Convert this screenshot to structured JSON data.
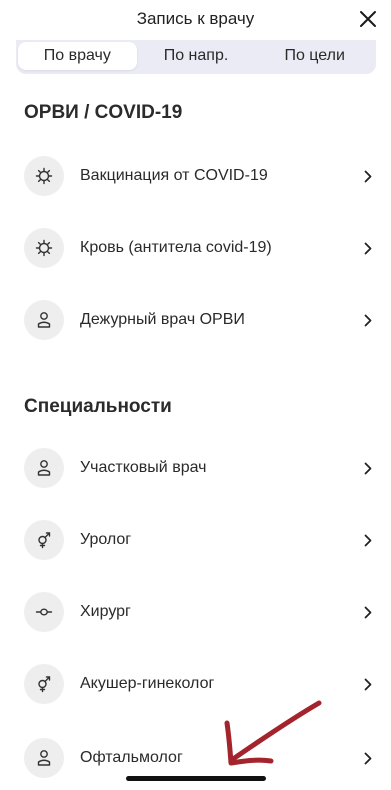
{
  "header": {
    "title": "Запись к врачу"
  },
  "tabs": [
    {
      "label": "По врачу",
      "active": true
    },
    {
      "label": "По напр.",
      "active": false
    },
    {
      "label": "По цели",
      "active": false
    }
  ],
  "sections": [
    {
      "title": "ОРВИ / COVID-19",
      "items": [
        {
          "label": "Вакцинация от COVID-19",
          "icon": "virus-icon"
        },
        {
          "label": "Кровь (антитела covid-19)",
          "icon": "virus-icon"
        },
        {
          "label": "Дежурный врач ОРВИ",
          "icon": "doctor-icon"
        }
      ]
    },
    {
      "title": "Специальности",
      "items": [
        {
          "label": "Участковый врач",
          "icon": "doctor-icon"
        },
        {
          "label": "Уролог",
          "icon": "gender-icon"
        },
        {
          "label": "Хирург",
          "icon": "scalpel-icon"
        },
        {
          "label": "Акушер-гинеколог",
          "icon": "gender-icon"
        },
        {
          "label": "Офтальмолог",
          "icon": "doctor-icon"
        }
      ]
    }
  ],
  "colors": {
    "accent_annotation": "#a3242c",
    "tab_bar": "#ebebf5",
    "icon_bg": "#eeeeee"
  }
}
